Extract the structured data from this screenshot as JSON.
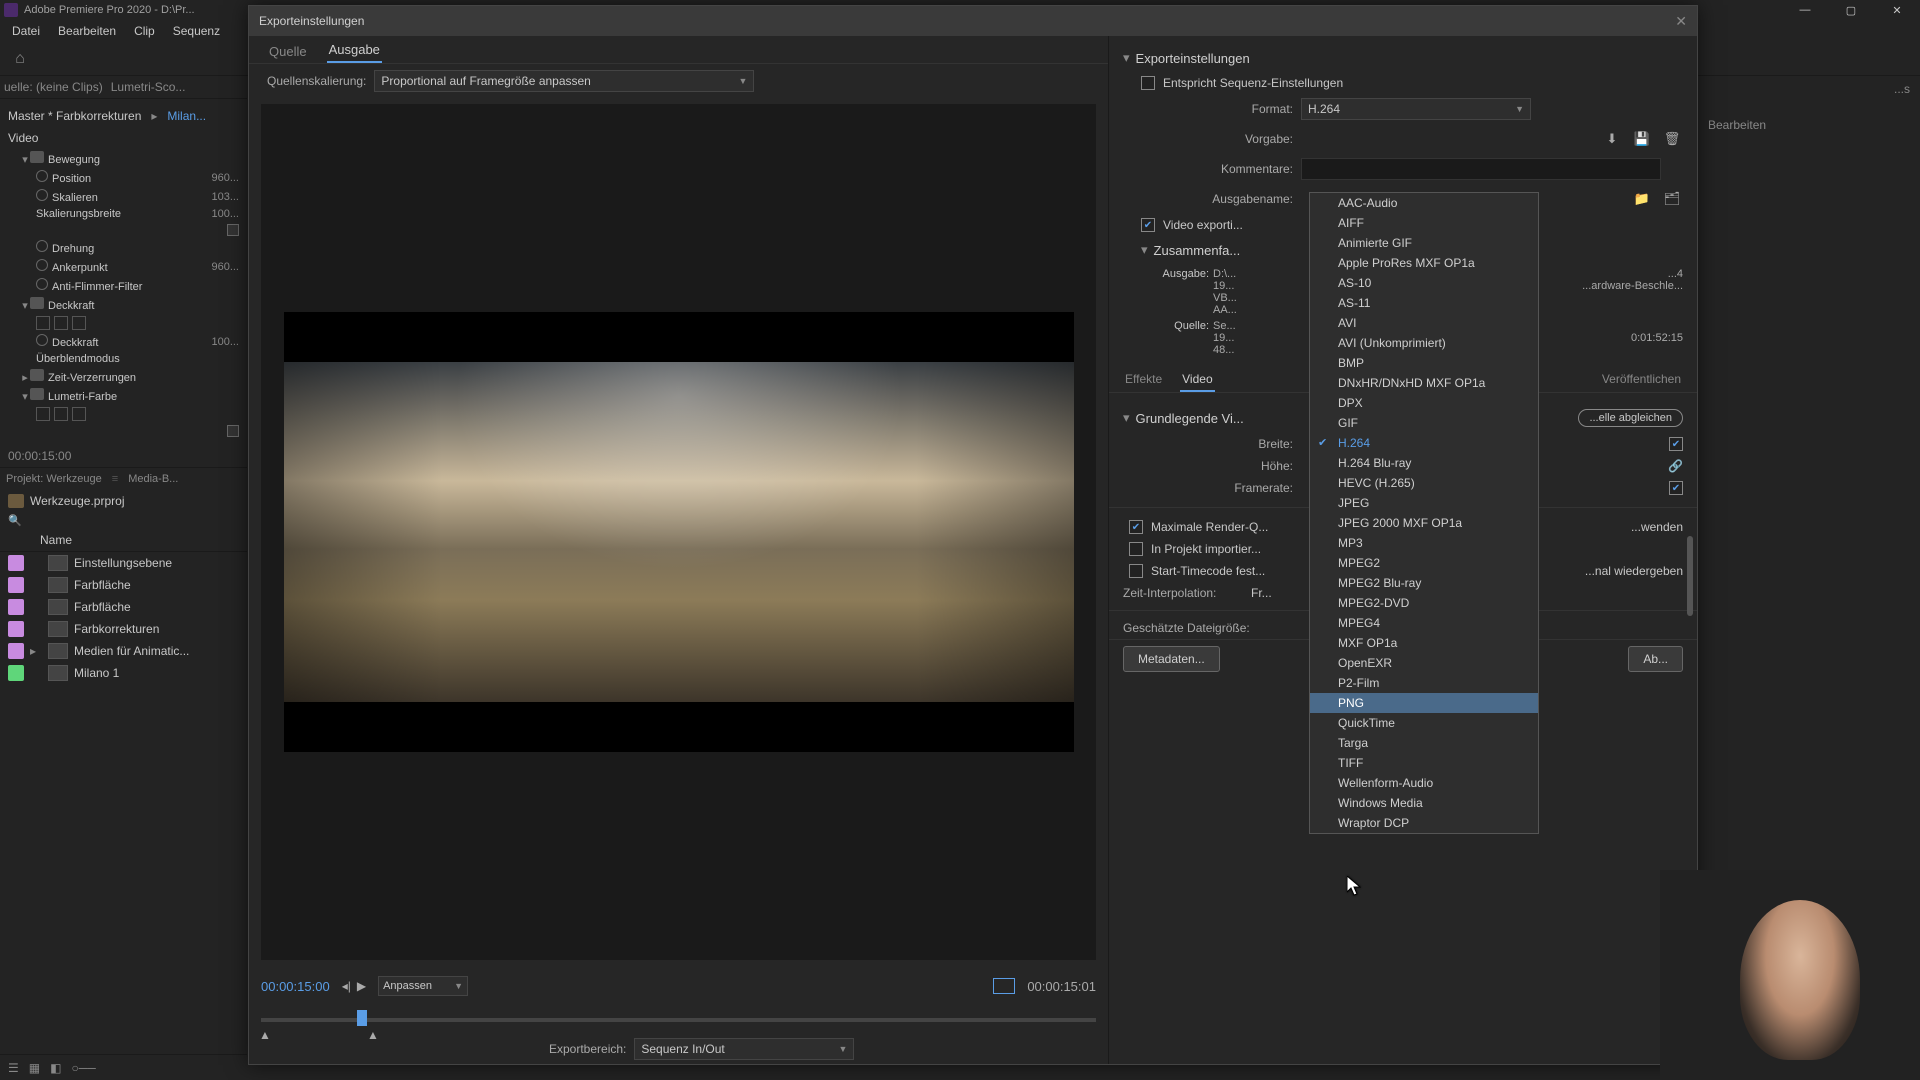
{
  "app": {
    "title": "Adobe Premiere Pro 2020 - D:\\Pr..."
  },
  "menubar": [
    "Datei",
    "Bearbeiten",
    "Clip",
    "Sequenz"
  ],
  "source_caption": "uelle: (keine Clips)",
  "lumetri_tab": "Lumetri-Sco...",
  "effects": {
    "master_label": "Master * Farbkorrekturen",
    "seq_label": "Milan...",
    "video_label": "Video",
    "groups": [
      {
        "name": "Bewegung",
        "props": [
          {
            "name": "Position",
            "val": "960..."
          },
          {
            "name": "Skalieren",
            "val": "103..."
          },
          {
            "name": "Skalierungsbreite",
            "val": "100..."
          }
        ]
      },
      {
        "name_only_props": [
          {
            "name": "Drehung",
            "val": ""
          },
          {
            "name": "Ankerpunkt",
            "val": "960..."
          },
          {
            "name": "Anti-Flimmer-Filter",
            "val": ""
          }
        ]
      },
      {
        "name": "Deckkraft",
        "props": [
          {
            "name": "Deckkraft",
            "val": "100..."
          },
          {
            "name": "Überblendmodus",
            "val": ""
          }
        ]
      },
      {
        "name": "Zeit-Verzerrungen",
        "props": []
      },
      {
        "name": "Lumetri-Farbe",
        "props": []
      }
    ],
    "timecode": "00:00:15:00"
  },
  "project": {
    "tab1": "Projekt: Werkzeuge",
    "tab2": "Media-B...",
    "file": "Werkzeuge.prproj",
    "col_name": "Name",
    "items": [
      {
        "color": "purple",
        "label": "Einstellungsebene"
      },
      {
        "color": "purple",
        "label": "Farbfläche"
      },
      {
        "color": "purple",
        "label": "Farbfläche"
      },
      {
        "color": "purple",
        "label": "Farbkorrekturen"
      },
      {
        "color": "purple",
        "label": "Medien für Animatic...",
        "expand": true
      },
      {
        "color": "green",
        "label": "Milano 1"
      }
    ]
  },
  "export": {
    "title": "Exporteinstellungen",
    "tabs": {
      "src": "Quelle",
      "out": "Ausgabe"
    },
    "scaling_label": "Quellenskalierung:",
    "scaling_value": "Proportional auf Framegröße anpassen",
    "tc_current": "00:00:15:00",
    "tc_total": "00:00:15:01",
    "fit_label": "Anpassen",
    "range_label": "Exportbereich:",
    "range_value": "Sequenz In/Out",
    "settings_header": "Exporteinstellungen",
    "match_seq": "Entspricht Sequenz-Einstellungen",
    "format_label": "Format:",
    "format_value": "H.264",
    "preset_label": "Vorgabe:",
    "comments_label": "Kommentare:",
    "output_label": "Ausgabename:",
    "video_export": "Video exporti...",
    "summary_header": "Zusammenfa...",
    "summary": {
      "out_label": "Ausgabe:",
      "out_lines": [
        "D:\\...",
        "19...",
        "VB...",
        "AA..."
      ],
      "out_right": [
        "...4",
        "...ardware-Beschle..."
      ],
      "src_label": "Quelle:",
      "src_lines": [
        "Se...",
        "19...",
        "48..."
      ],
      "src_right": "0:01:52:15"
    },
    "tabs2": {
      "fx": "Effekte",
      "video": "Video",
      "publish": "Veröffentlichen"
    },
    "basic_header": "Grundlegende Vi...",
    "match_btn": "...elle abgleichen",
    "width_label": "Breite:",
    "height_label": "Höhe:",
    "fps_label": "Framerate:",
    "max_quality": "Maximale Render-Q...",
    "max_quality_tail": "...wenden",
    "import_proj": "In Projekt importier...",
    "start_tc": "Start-Timecode fest...",
    "start_tc_tail": "...nal wiedergeben",
    "interp_label": "Zeit-Interpolation:",
    "interp_value": "Fr...",
    "filesize_label": "Geschätzte Dateigröße:",
    "metadata_btn": "Metadaten...",
    "cancel_btn": "Ab..."
  },
  "format_options": [
    "AAC-Audio",
    "AIFF",
    "Animierte GIF",
    "Apple ProRes MXF OP1a",
    "AS-10",
    "AS-11",
    "AVI",
    "AVI (Unkomprimiert)",
    "BMP",
    "DNxHR/DNxHD MXF OP1a",
    "DPX",
    "GIF",
    "H.264",
    "H.264 Blu-ray",
    "HEVC (H.265)",
    "JPEG",
    "JPEG 2000 MXF OP1a",
    "MP3",
    "MPEG2",
    "MPEG2 Blu-ray",
    "MPEG2-DVD",
    "MPEG4",
    "MXF OP1a",
    "OpenEXR",
    "P2-Film",
    "PNG",
    "QuickTime",
    "Targa",
    "TIFF",
    "Wellenform-Audio",
    "Windows Media",
    "Wraptor DCP"
  ],
  "format_selected": "H.264",
  "format_hover": "PNG",
  "right_bg": {
    "a": "...s",
    "b": "Bearbeiten"
  }
}
